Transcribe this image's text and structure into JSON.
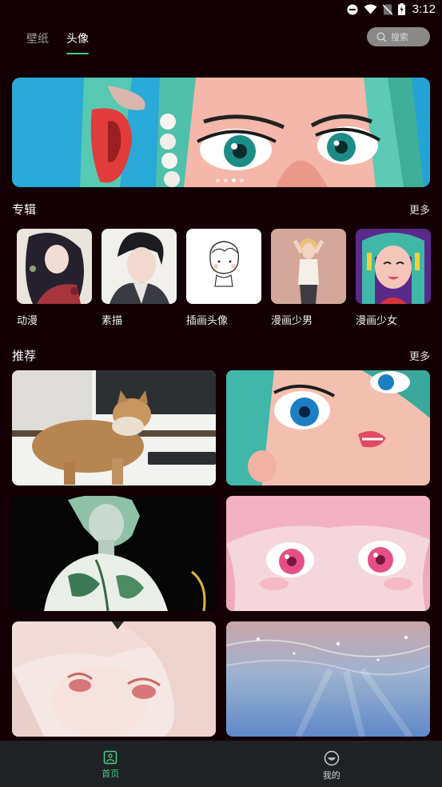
{
  "status_bar": {
    "time": "3:12",
    "icons": [
      "do-not-disturb-icon",
      "wifi-icon",
      "no-sim-icon",
      "battery-charging-icon"
    ]
  },
  "tabs": [
    {
      "label": "壁纸",
      "active": false
    },
    {
      "label": "头像",
      "active": true
    }
  ],
  "search": {
    "placeholder": "搜索",
    "icon": "search-icon"
  },
  "banner": {
    "page_count": 4,
    "active_page": 3
  },
  "albums_section": {
    "title": "专辑",
    "more_label": "更多",
    "items": [
      {
        "label": "动漫"
      },
      {
        "label": "素描"
      },
      {
        "label": "插画头像"
      },
      {
        "label": "漫画少男"
      },
      {
        "label": "漫画少女"
      }
    ]
  },
  "recommend_section": {
    "title": "推荐",
    "more_label": "更多"
  },
  "bottom_nav": {
    "items": [
      {
        "label": "首页",
        "icon": "image-icon",
        "active": true
      },
      {
        "label": "我的",
        "icon": "smile-icon",
        "active": false
      }
    ]
  },
  "colors": {
    "background": "#140004",
    "accent": "#4cc98a",
    "nav_background": "#1f2224",
    "search_pill": "#8b8888"
  }
}
